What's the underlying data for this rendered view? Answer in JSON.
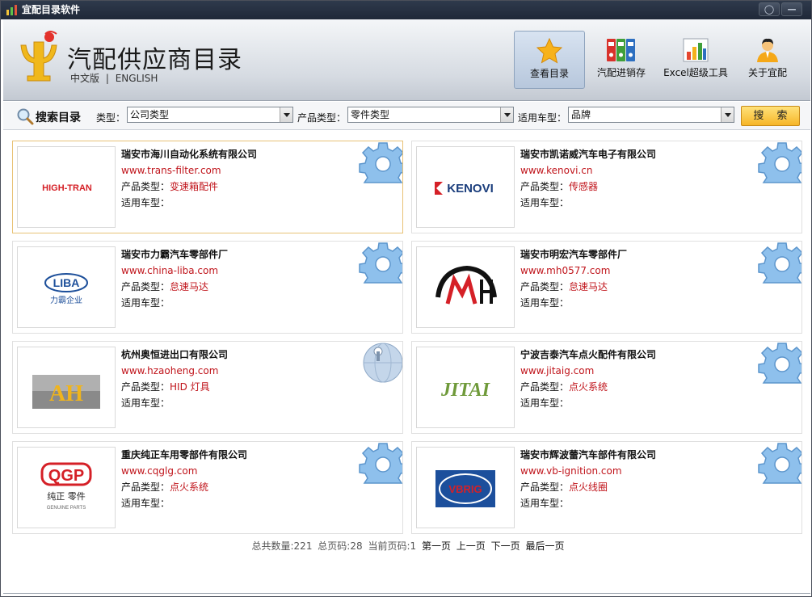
{
  "window": {
    "title": "宜配目录软件"
  },
  "header": {
    "title": "汽配供应商目录",
    "lang_cn": "中文版",
    "lang_sep": "|",
    "lang_en": "ENGLISH",
    "nav": [
      {
        "label": "查看目录",
        "icon": "star-icon",
        "active": true
      },
      {
        "label": "汽配进销存",
        "icon": "binders-icon"
      },
      {
        "label": "Excel超级工具",
        "icon": "bar-chart-icon"
      },
      {
        "label": "关于宜配",
        "icon": "person-icon"
      }
    ]
  },
  "search": {
    "title": "搜索目录",
    "type_label": "类型：",
    "type_value": "公司类型",
    "product_label": "产品类型：",
    "product_value": "零件类型",
    "vehicle_label": "适用车型：",
    "vehicle_value": "品牌",
    "button": "搜 索"
  },
  "labels": {
    "product": "产品类型：",
    "vehicle": "适用车型："
  },
  "companies": [
    {
      "name": "瑞安市海川自动化系统有限公司",
      "url": "www.trans-filter.com",
      "product": "变速箱配件",
      "vehicle": "",
      "logo": "HIGH-TRAN"
    },
    {
      "name": "瑞安市凯诺威汽车电子有限公司",
      "url": "www.kenovi.cn",
      "product": "传感器",
      "vehicle": "",
      "logo": "KENOVI"
    },
    {
      "name": "瑞安市力霸汽车零部件厂",
      "url": "www.china-liba.com",
      "product": "怠速马达",
      "vehicle": "",
      "logo": "LIBA",
      "logo_sub": "力霸企业"
    },
    {
      "name": "瑞安市明宏汽车零部件厂",
      "url": "www.mh0577.com",
      "product": "怠速马达",
      "vehicle": "",
      "logo": "MH"
    },
    {
      "name": "杭州奥恒进出口有限公司",
      "url": "www.hzaoheng.com",
      "product": "HID 灯具",
      "vehicle": "",
      "logo": "AH"
    },
    {
      "name": "宁波吉泰汽车点火配件有限公司",
      "url": "www.jitaig.com",
      "product": "点火系统",
      "vehicle": "",
      "logo": "JITAI"
    },
    {
      "name": "重庆纯正车用零部件有限公司",
      "url": "www.cqglg.com",
      "product": "点火系统",
      "vehicle": "",
      "logo": "QGP",
      "logo_sub": "纯正 零件",
      "logo_sub2": "GENUINE PARTS"
    },
    {
      "name": "瑞安市辉波蕾汽车部件有限公司",
      "url": "www.vb-ignition.com",
      "product": "点火线圈",
      "vehicle": "",
      "logo": "VBRIG"
    }
  ],
  "pager": {
    "total": "总共数量:221",
    "pages": "总页码:28",
    "current": "当前页码:1",
    "first": "第一页",
    "prev": "上一页",
    "next": "下一页",
    "last": "最后一页"
  },
  "colors": {
    "accent": "#c0141b",
    "button": "#f6b528",
    "gear": "#7fb4e6"
  }
}
